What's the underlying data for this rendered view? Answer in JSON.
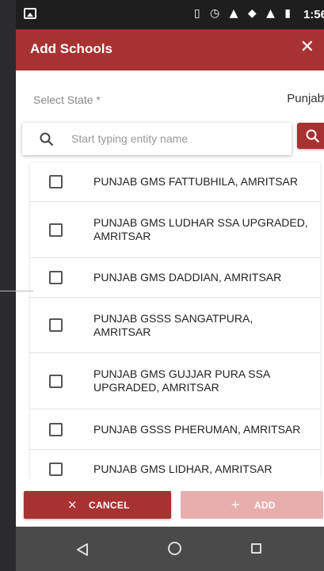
{
  "status_bar": {
    "time": "1:56",
    "icons": "▯ ◷ ▲ ◆ ▲ ▮"
  },
  "app_bar": {
    "title": "Add Schools",
    "close_icon": "close-icon"
  },
  "state_select": {
    "label": "Select State *",
    "value": "Punjab"
  },
  "search": {
    "placeholder": "Start typing entity name"
  },
  "schools": [
    {
      "name": "PUNJAB GMS FATTUBHILA, AMRITSAR",
      "checked": false
    },
    {
      "name": "PUNJAB GMS LUDHAR SSA UPGRADED, AMRITSAR",
      "checked": false
    },
    {
      "name": "PUNJAB GMS DADDIAN, AMRITSAR",
      "checked": false
    },
    {
      "name": "PUNJAB GSSS SANGATPURA, AMRITSAR",
      "checked": false
    },
    {
      "name": "PUNJAB GMS GUJJAR PURA SSA UPGRADED, AMRITSAR",
      "checked": false
    },
    {
      "name": "PUNJAB GSSS PHERUMAN, AMRITSAR",
      "checked": false
    },
    {
      "name": "PUNJAB GMS LIDHAR, AMRITSAR",
      "checked": false
    }
  ],
  "actions": {
    "cancel_label": "CANCEL",
    "cancel_icon": "×",
    "add_label": "ADD",
    "add_icon": "+"
  },
  "colors": {
    "primary": "#a83232",
    "disabled": "#e8aeae"
  }
}
